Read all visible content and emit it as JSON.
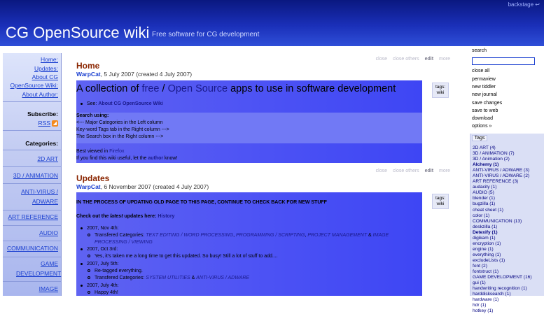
{
  "header": {
    "backstage": "backstage ↩",
    "title": "CG OpenSource wiki",
    "subtitle": "Free software for CG development"
  },
  "main_menu": {
    "links": [
      "Home:",
      "Updates:",
      "About CG",
      "OpenSource Wiki:",
      "About Author:"
    ],
    "subscribe_label": "Subscribe:",
    "rss_label": "RSS",
    "categories_label": "Categories:",
    "categories": [
      "2D ART",
      "3D / ANIMATION",
      "ANTI-VIRUS / ADWARE",
      "ART REFERENCE",
      "AUDIO",
      "COMMUNICATION",
      "GAME DEVELOPMENT",
      "IMAGE"
    ]
  },
  "tiddler_toolbar": {
    "close": "close",
    "close_others": "close others",
    "edit": "edit",
    "more": "more"
  },
  "tiddler_home": {
    "title": "Home",
    "author": "WarpCat",
    "date_text": ", 5 July 2007 (created 4 July 2007)",
    "tags_label": "tags:",
    "tag": "wiki",
    "banner_pre": "A collection of ",
    "banner_free": "free",
    "banner_sep": " / ",
    "banner_os": "Open Source",
    "banner_post": " apps to use in software development",
    "see_label": "See: ",
    "see_link": "About CG OpenSource Wiki",
    "search_using": "Search using:",
    "search_line1": "<--- Major Categories in the Left column",
    "search_line2": "Key-word Tags tab in the Right column --->",
    "search_line3": "The Search box in the Right column --->",
    "viewed_pre": "Best viewed in ",
    "viewed_link": "Firefox",
    "useful_pre": "If you find this wiki useful, let the ",
    "useful_link": "author",
    "useful_post": " know!"
  },
  "tiddler_updates": {
    "title": "Updates",
    "author": "WarpCat",
    "date_text": ", 6 November 2007 (created 4 July 2007)",
    "tags_label": "tags:",
    "tag": "wiki",
    "notice": "IN THE PROCESS OF UPDATING OLD PAGE TO THIS PAGE, CONTINUE TO CHECK BACK FOR NEW STUFF",
    "checkout_pre": "Check out the ",
    "checkout_latest": "latest",
    "checkout_mid": " updates here: ",
    "checkout_link": "History",
    "e1_date": "2007, Nov 4th:",
    "e1_pre": "Transfered Categories: ",
    "e1_c1": "TEXT EDITING / WORD PROCESSING",
    "e1_c2": "PROGRAMMING / SCRIPTING",
    "e1_c3": "PROJECT MANAGEMENT",
    "e1_c4": "IMAGE",
    "e1_c4b": "PROCESSING / VIEWING",
    "e2_date": "2007, Oct 3rd:",
    "e2_text": "Yes, it's taken me a long time to get this updated. So busy! Still a lot of stuff to add....",
    "e3_date": "2007, July 5th:",
    "e3_text1": "Re-tagged everything.",
    "e3_pre": "Transfered Categories: ",
    "e3_c1": "SYSTEM UTILITIES",
    "e3_c2": "ANTI-VIRUS / ADWARE",
    "e4_date": "2007, July 4th:",
    "e4_text": "Happy 4th!"
  },
  "sidebar": {
    "search_label": "search",
    "search_value": "",
    "items": [
      "close all",
      "permaview",
      "new tiddler",
      "new journal",
      "save changes",
      "save to web",
      "download",
      "options »"
    ],
    "tags_tab": "Tags",
    "tags": [
      {
        "label": "2D ART (4)",
        "strong": false
      },
      {
        "label": "3D / ANIMATION (7)",
        "strong": false
      },
      {
        "label": "3D / Animation (2)",
        "strong": false
      },
      {
        "label": "Alchemy (1)",
        "strong": true
      },
      {
        "label": "ANTI-VIRUS / ADWARE (3)",
        "strong": false
      },
      {
        "label": "ANTI-VIRUS / ADWARE (2)",
        "strong": false
      },
      {
        "label": "ART REFERENCE (3)",
        "strong": false
      },
      {
        "label": "audacity (1)",
        "strong": false
      },
      {
        "label": "AUDIO (5)",
        "strong": false
      },
      {
        "label": "blender (1)",
        "strong": false
      },
      {
        "label": "bugzilla (1)",
        "strong": false
      },
      {
        "label": "cheat sheet (1)",
        "strong": false
      },
      {
        "label": "color (1)",
        "strong": false
      },
      {
        "label": "COMMUNICATION (13)",
        "strong": false
      },
      {
        "label": "deskzilla (1)",
        "strong": false
      },
      {
        "label": "Detexify (1)",
        "strong": true
      },
      {
        "label": "digikam (1)",
        "strong": false
      },
      {
        "label": "encryption (1)",
        "strong": false
      },
      {
        "label": "engine (1)",
        "strong": false
      },
      {
        "label": "everything (1)",
        "strong": false
      },
      {
        "label": "excludeLists (1)",
        "strong": false
      },
      {
        "label": "font (2)",
        "strong": false
      },
      {
        "label": "fontstruct (1)",
        "strong": false
      },
      {
        "label": "GAME DEVELOPMENT (16)",
        "strong": false
      },
      {
        "label": "gui (1)",
        "strong": false
      },
      {
        "label": "handwriting recognition (1)",
        "strong": false
      },
      {
        "label": "harddisksearch (1)",
        "strong": false
      },
      {
        "label": "hardware (1)",
        "strong": false
      },
      {
        "label": "hdr (1)",
        "strong": false
      },
      {
        "label": "hotkey (1)",
        "strong": false
      }
    ]
  }
}
